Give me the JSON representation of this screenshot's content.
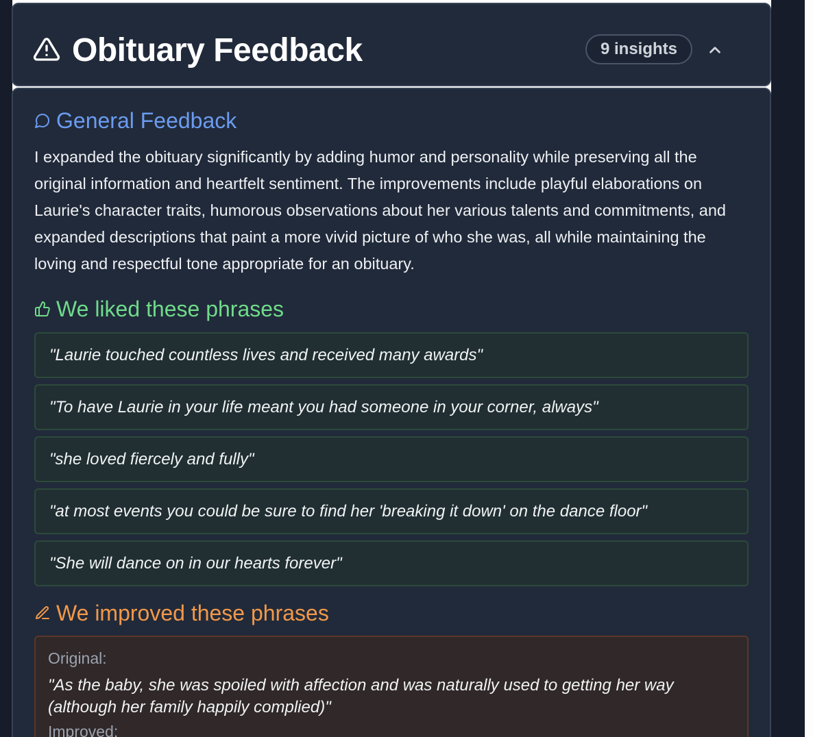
{
  "header": {
    "title": "Obituary Feedback",
    "insights_badge": "9 insights",
    "icon": "warning-triangle-icon",
    "collapse_icon": "chevron-up-icon"
  },
  "general": {
    "heading": "General Feedback",
    "icon": "message-circle-icon",
    "text": "I expanded the obituary significantly by adding humor and personality while preserving all the original information and heartfelt sentiment. The improvements include playful elaborations on Laurie's character traits, humorous observations about her various talents and commitments, and expanded descriptions that paint a more vivid picture of who she was, all while maintaining the loving and respectful tone appropriate for an obituary."
  },
  "liked": {
    "heading": "We liked these phrases",
    "icon": "thumbs-up-icon",
    "phrases": [
      "\"Laurie touched countless lives and received many awards\"",
      "\"To have Laurie in your life meant you had someone in your corner, always\"",
      "\"she loved fiercely and fully\"",
      "\"at most events you could be sure to find her 'breaking it down' on the dance floor\"",
      "\"She will dance on in our hearts forever\""
    ]
  },
  "improved": {
    "heading": "We improved these phrases",
    "icon": "pencil-icon",
    "items": [
      {
        "original_label": "Original:",
        "original_text": "\"As the baby, she was spoiled with affection and was naturally used to getting her way (although her family happily complied)\"",
        "improved_label": "Improved:"
      }
    ]
  },
  "colors": {
    "general": "#6b9cf0",
    "liked": "#6fdb8a",
    "improved": "#f2984a",
    "card_bg": "#212a3a"
  }
}
